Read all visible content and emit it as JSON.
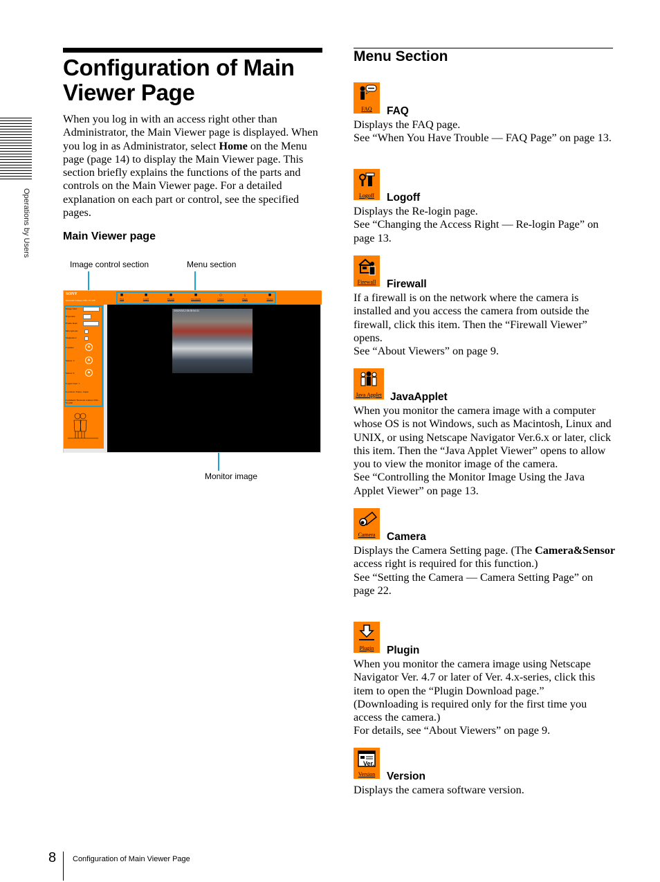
{
  "side_tab": {
    "label": "Operations by Users"
  },
  "left": {
    "title": "Configuration of Main Viewer Page",
    "intro_parts": {
      "p1": "When you log in with an access right other than Administrator, the Main Viewer page is displayed. When you log in as Administrator, select ",
      "bold": "Home",
      "p2": " on the Menu page (page 14) to display the Main Viewer page. This section briefly explains the functions of the parts and controls on the Main Viewer page.  For a detailed explanation on each part or control, see the specified pages."
    },
    "subheading": "Main Viewer page",
    "figure": {
      "callouts": {
        "image_control": "Image control section",
        "menu": "Menu section",
        "monitor": "Monitor image"
      },
      "brand": "SONY",
      "model": "Network Camera SNC-VL10P",
      "controls": [
        {
          "label": "Image Size:",
          "type": "select",
          "value": "320x240"
        },
        {
          "label": "Exposure:",
          "type": "select",
          "value": "0"
        },
        {
          "label": "Frame Rate:",
          "type": "select",
          "value": "Fastest"
        },
        {
          "label": "Microphone:",
          "type": "checkbox"
        },
        {
          "label": "Singleshot:",
          "type": "checkbox"
        },
        {
          "label": "Capture:",
          "type": "button"
        },
        {
          "label": "Sensor 1:",
          "type": "button"
        },
        {
          "label": "Sensor 2:",
          "type": "button"
        }
      ],
      "status": {
        "logon_user": "Logon User: 1",
        "location": "Location: Tokyo, Japan",
        "comment": "Comment: Network Camera SNC-VL10P"
      },
      "menu_items": [
        "FAQ",
        "Logoff",
        "Firewall",
        "Java Applet",
        "Camera",
        "Plugin",
        "Version"
      ],
      "timestamp": "2002/03/12 08:08:54.01"
    }
  },
  "right": {
    "title": "Menu Section",
    "items": [
      {
        "icon": "faq-icon",
        "icon_label": "FAQ",
        "heading": "FAQ",
        "body": "Displays the FAQ page.\nSee “When You Have Trouble — FAQ Page” on page 13."
      },
      {
        "icon": "logoff-icon",
        "icon_label": "Logoff",
        "heading": "Logoff",
        "body": "Displays the Re-login page.\nSee “Changing the Access Right — Re-login Page” on page 13."
      },
      {
        "icon": "firewall-icon",
        "icon_label": "Firewall",
        "heading": "Firewall",
        "body": "If a firewall is on the network where the camera is installed and you access the camera from outside the firewall, click this item.  Then the “Firewall Viewer” opens.\nSee “About Viewers” on page 9."
      },
      {
        "icon": "java-applet-icon",
        "icon_label": "Java Applet",
        "heading": "JavaApplet",
        "body": "When you monitor the camera image with a computer whose OS is not Windows, such as Macintosh, Linux and UNIX, or using Netscape Navigator Ver.6.x or later, click this item.  Then the “Java Applet Viewer” opens to allow you to view the monitor image of the camera.\nSee “Controlling the Monitor Image Using the Java Applet Viewer” on page 13."
      },
      {
        "icon": "camera-icon",
        "icon_label": "Camera",
        "heading": "Camera",
        "body_p1": "Displays the Camera Setting page.  (The ",
        "body_bold": "Camera&Sensor",
        "body_p2": " access right is required for this function.)\nSee “Setting the Camera — Camera Setting Page” on page 22."
      },
      {
        "icon": "plugin-icon",
        "icon_label": "Plugin",
        "heading": "Plugin",
        "body": "When you monitor the camera image using Netscape Navigator Ver. 4.7 or later of Ver. 4.x-series, click this item to open the “Plugin Download page.”\n(Downloading is required only for the first time you access the camera.)\nFor details, see “About Viewers” on page 9."
      },
      {
        "icon": "version-icon",
        "icon_label": "Version",
        "heading": "Version",
        "body": "Displays the camera software version."
      }
    ]
  },
  "footer": {
    "page_number": "8",
    "running_title": "Configuration of Main Viewer Page"
  },
  "colors": {
    "accent_orange": "#ff8000",
    "callout_blue": "#1aa3d9"
  }
}
